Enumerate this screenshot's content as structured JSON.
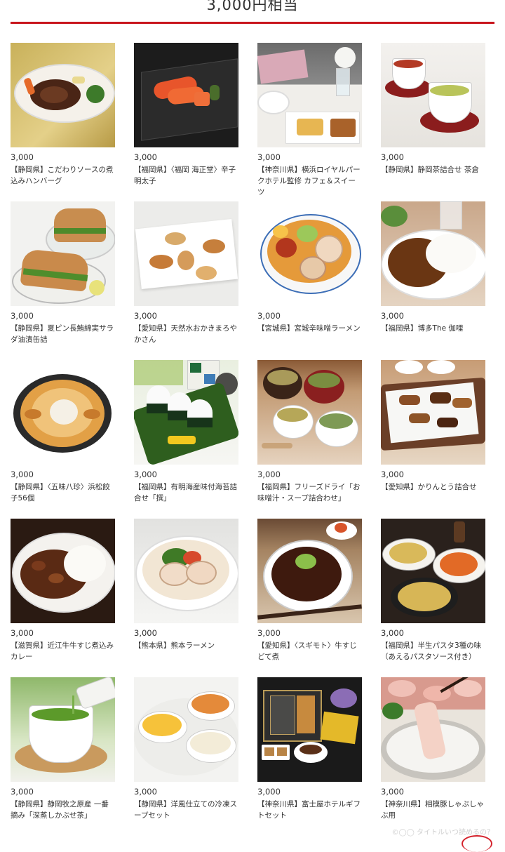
{
  "header": {
    "title": "3,000円相当"
  },
  "products": [
    {
      "price": "3,000",
      "name": "【静岡県】こだわりソースの煮込みハンバーグ"
    },
    {
      "price": "3,000",
      "name": "【福岡県】〈福岡 海正堂〉辛子明太子"
    },
    {
      "price": "3,000",
      "name": "【神奈川県】横浜ロイヤルパークホテル監修 カフェ＆スイーツ"
    },
    {
      "price": "3,000",
      "name": "【静岡県】静岡茶詰合せ 茶倉"
    },
    {
      "price": "3,000",
      "name": "【静岡県】夏ピン長鮪綿実サラダ油漬缶詰"
    },
    {
      "price": "3,000",
      "name": "【愛知県】天然水おかきまろやかさん"
    },
    {
      "price": "3,000",
      "name": "【宮城県】宮城辛味噌ラーメン"
    },
    {
      "price": "3,000",
      "name": "【福岡県】博多The 伽哩"
    },
    {
      "price": "3,000",
      "name": "【静岡県】〈五味八珍〉浜松餃子56個"
    },
    {
      "price": "3,000",
      "name": "【福岡県】有明海産味付海苔詰合せ「撰」"
    },
    {
      "price": "3,000",
      "name": "【福岡県】フリーズドライ「お味噌汁・スープ詰合わせ」"
    },
    {
      "price": "3,000",
      "name": "【愛知県】かりんとう詰合せ"
    },
    {
      "price": "3,000",
      "name": "【滋賀県】近江牛牛すじ煮込みカレー"
    },
    {
      "price": "3,000",
      "name": "【熊本県】熊本ラーメン"
    },
    {
      "price": "3,000",
      "name": "【愛知県】〈スギモト〉牛すじどて煮"
    },
    {
      "price": "3,000",
      "name": "【福岡県】半生パスタ3種の味（あえるパスタソース付き）"
    },
    {
      "price": "3,000",
      "name": "【静岡県】静岡牧之原産 一番摘み「深蒸しかぶせ茶」"
    },
    {
      "price": "3,000",
      "name": "【静岡県】洋風仕立ての冷凍スープセット"
    },
    {
      "price": "3,000",
      "name": "【神奈川県】富士屋ホテルギフトセット"
    },
    {
      "price": "3,000",
      "name": "【神奈川県】相模豚しゃぶしゃぶ用"
    }
  ],
  "watermark": "©◯◯ タイトルいつ読めるの？",
  "colors": {
    "accent": "#c8161d"
  }
}
